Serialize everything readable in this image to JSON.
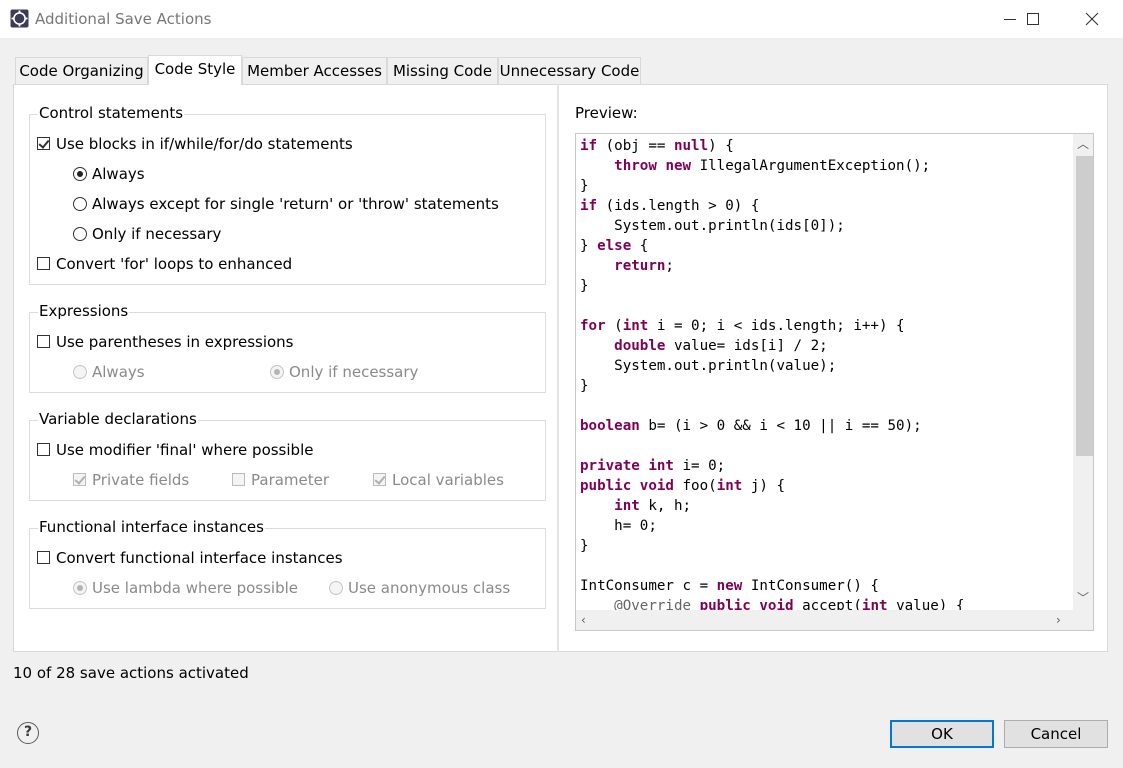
{
  "window": {
    "title": "Additional Save Actions"
  },
  "tabs": [
    {
      "label": "Code Organizing",
      "selected": false
    },
    {
      "label": "Code Style",
      "selected": true
    },
    {
      "label": "Member Accesses",
      "selected": false
    },
    {
      "label": "Missing Code",
      "selected": false
    },
    {
      "label": "Unnecessary Code",
      "selected": false
    }
  ],
  "groups": {
    "control": {
      "title": "Control statements",
      "use_blocks": {
        "label": "Use blocks in if/while/for/do statements",
        "checked": true
      },
      "always": {
        "label": "Always",
        "checked": true
      },
      "always_except": {
        "label": "Always except for single 'return' or 'throw' statements",
        "checked": false
      },
      "only_if_necessary": {
        "label": "Only if necessary",
        "checked": false
      },
      "convert_for": {
        "label": "Convert 'for' loops to enhanced",
        "checked": false
      }
    },
    "expressions": {
      "title": "Expressions",
      "use_parentheses": {
        "label": "Use parentheses in expressions",
        "checked": false
      },
      "always": {
        "label": "Always",
        "checked": false
      },
      "only_if_necessary": {
        "label": "Only if necessary",
        "checked": true
      }
    },
    "variables": {
      "title": "Variable declarations",
      "use_final": {
        "label": "Use modifier 'final' where possible",
        "checked": false
      },
      "private_fields": {
        "label": "Private fields",
        "checked": true
      },
      "parameter": {
        "label": "Parameter",
        "checked": false
      },
      "local_variables": {
        "label": "Local variables",
        "checked": true
      }
    },
    "functional": {
      "title": "Functional interface instances",
      "convert": {
        "label": "Convert functional interface instances",
        "checked": false
      },
      "use_lambda": {
        "label": "Use lambda where possible",
        "checked": true
      },
      "use_anonymous": {
        "label": "Use anonymous class",
        "checked": false
      }
    }
  },
  "preview": {
    "label": "Preview:",
    "code_lines": [
      "if (obj == null) {",
      "    throw new IllegalArgumentException();",
      "}",
      "if (ids.length > 0) {",
      "    System.out.println(ids[0]);",
      "} else {",
      "    return;",
      "}",
      "",
      "for (int i = 0; i < ids.length; i++) {",
      "    double value= ids[i] / 2;",
      "    System.out.println(value);",
      "}",
      "",
      "boolean b= (i > 0 && i < 10 || i == 50);",
      "",
      "private int i= 0;",
      "public void foo(int j) {",
      "    int k, h;",
      "    h= 0;",
      "}",
      "",
      "IntConsumer c = new IntConsumer() {",
      "    @Override public void accept(int value) {"
    ],
    "keyword_color": "#7f0055"
  },
  "status": "10 of 28 save actions activated",
  "buttons": {
    "ok": "OK",
    "cancel": "Cancel",
    "help": "?"
  },
  "colors": {
    "default_button_border": "#0078d7",
    "keyword": "#7f0055"
  }
}
